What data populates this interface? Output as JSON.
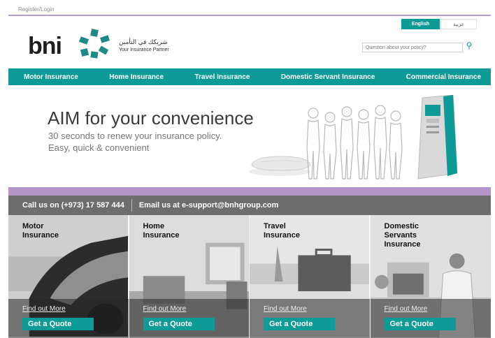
{
  "top": {
    "register_login": "Register/Login"
  },
  "brand": {
    "logo_text": "bni",
    "tagline_ar": "شريكك في التأمين",
    "tagline_en": "Your Insurance Partner"
  },
  "lang": {
    "english": "English",
    "arabic": "عربية"
  },
  "search": {
    "placeholder": "Question about your policy?"
  },
  "nav": {
    "items": [
      "Motor Insurance",
      "Home Insurance",
      "Travel Insurance",
      "Domestic Servant Insurance",
      "Commercial Insurance"
    ]
  },
  "banner": {
    "title": "AIM for your convenience",
    "sub1": "30 seconds to renew your insurance policy.",
    "sub2": "Easy, quick & convenient"
  },
  "contact": {
    "call": "Call us on (+973) 17 587 444",
    "email": "Email us at e-support@bnhgroup.com"
  },
  "cards": [
    {
      "title": "Motor\nInsurance",
      "find": "Find out More",
      "quote": "Get a Quote"
    },
    {
      "title": "Home\nInsurance",
      "find": "Find out More",
      "quote": "Get a Quote"
    },
    {
      "title": "Travel\nInsurance",
      "find": "Find out More",
      "quote": "Get a Quote"
    },
    {
      "title": "Domestic\nServants\nInsurance",
      "find": "Find out More",
      "quote": "Get a Quote"
    }
  ],
  "colors": {
    "teal": "#0e9a97",
    "purple": "#b595c8",
    "strip": "#6d6d6d"
  }
}
